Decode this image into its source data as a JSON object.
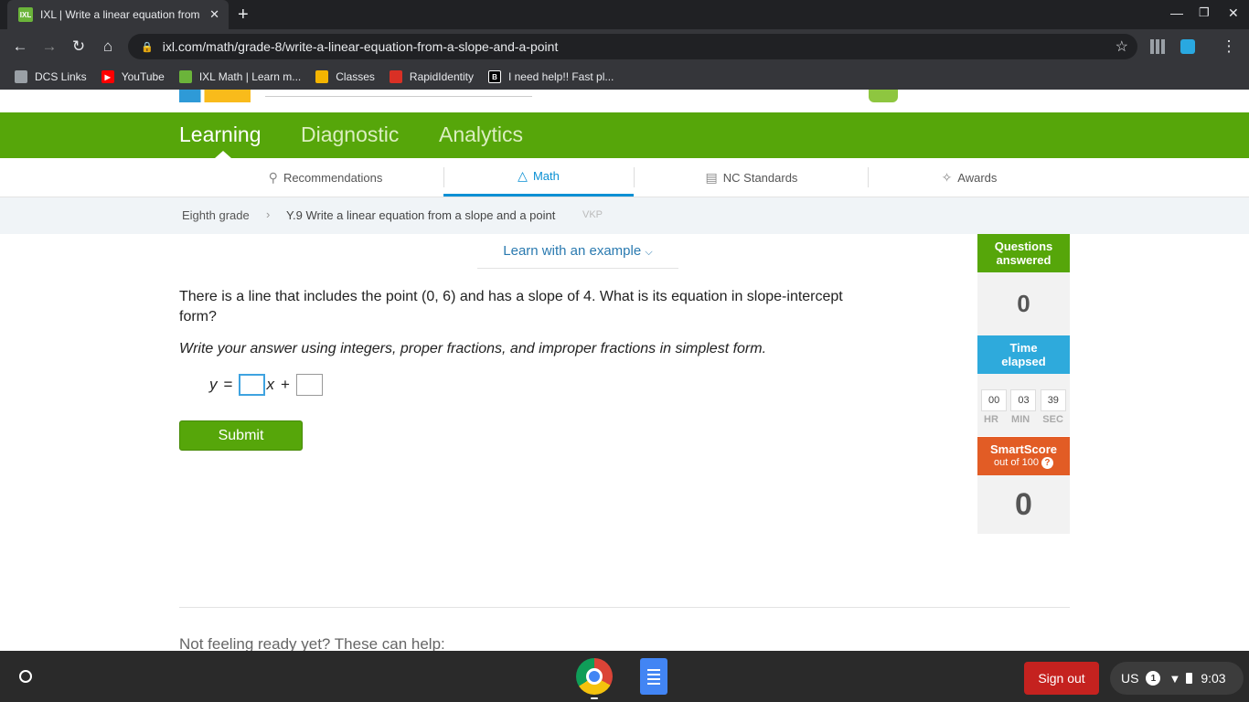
{
  "browser": {
    "tab_title": "IXL | Write a linear equation from",
    "tab_favicon_text": "IXL",
    "url": "ixl.com/math/grade-8/write-a-linear-equation-from-a-slope-and-a-point",
    "bookmarks": [
      {
        "label": "DCS Links",
        "icon": "folder-icon",
        "color": "#9aa0a6"
      },
      {
        "label": "YouTube",
        "icon": "youtube-icon",
        "color": "#ff0000"
      },
      {
        "label": "IXL Math | Learn m...",
        "icon": "ixl-icon",
        "color": "#6bb43a"
      },
      {
        "label": "Classes",
        "icon": "classroom-icon",
        "color": "#f4b400"
      },
      {
        "label": "RapidIdentity",
        "icon": "rapididentity-icon",
        "color": "#d93025"
      },
      {
        "label": "I need help!! Fast pl...",
        "icon": "brainly-icon",
        "color": "#000000"
      }
    ]
  },
  "nav": {
    "items": [
      "Learning",
      "Diagnostic",
      "Analytics"
    ],
    "active": "Learning"
  },
  "subnav": {
    "items": [
      {
        "label": "Recommendations",
        "icon": "recommendations-icon"
      },
      {
        "label": "Math",
        "icon": "math-pyramid-icon"
      },
      {
        "label": "NC Standards",
        "icon": "standards-icon"
      },
      {
        "label": "Awards",
        "icon": "awards-icon"
      }
    ],
    "active": "Math"
  },
  "breadcrumb": {
    "grade": "Eighth grade",
    "skill": "Y.9 Write a linear equation from a slope and a point",
    "code": "VKP"
  },
  "learn_link": "Learn with an example",
  "question": {
    "text": "There is a line that includes the point (0, 6) and has a slope of 4. What is its equation in slope-intercept form?",
    "instruction": "Write your answer using integers, proper fractions, and improper fractions in simplest form.",
    "eq_y": "y",
    "eq_equals": "=",
    "eq_x": "x",
    "eq_plus": "+",
    "slope_value": "",
    "intercept_value": ""
  },
  "submit_label": "Submit",
  "helper_text": "Not feeling ready yet? These can help:",
  "sidebar": {
    "questions_label_1": "Questions",
    "questions_label_2": "answered",
    "questions_value": "0",
    "time_label_1": "Time",
    "time_label_2": "elapsed",
    "time_hr": "00",
    "time_min": "03",
    "time_sec": "39",
    "unit_hr": "HR",
    "unit_min": "MIN",
    "unit_sec": "SEC",
    "smartscore_label": "SmartScore",
    "smartscore_sub": "out of 100",
    "smartscore_help": "?",
    "smartscore_value": "0",
    "colors": {
      "questions": "#56a60a",
      "time": "#2eaadc",
      "smartscore": "#e25c25"
    }
  },
  "shelf": {
    "signout": "Sign out",
    "locale": "US",
    "notifications": "1",
    "time": "9:03"
  }
}
